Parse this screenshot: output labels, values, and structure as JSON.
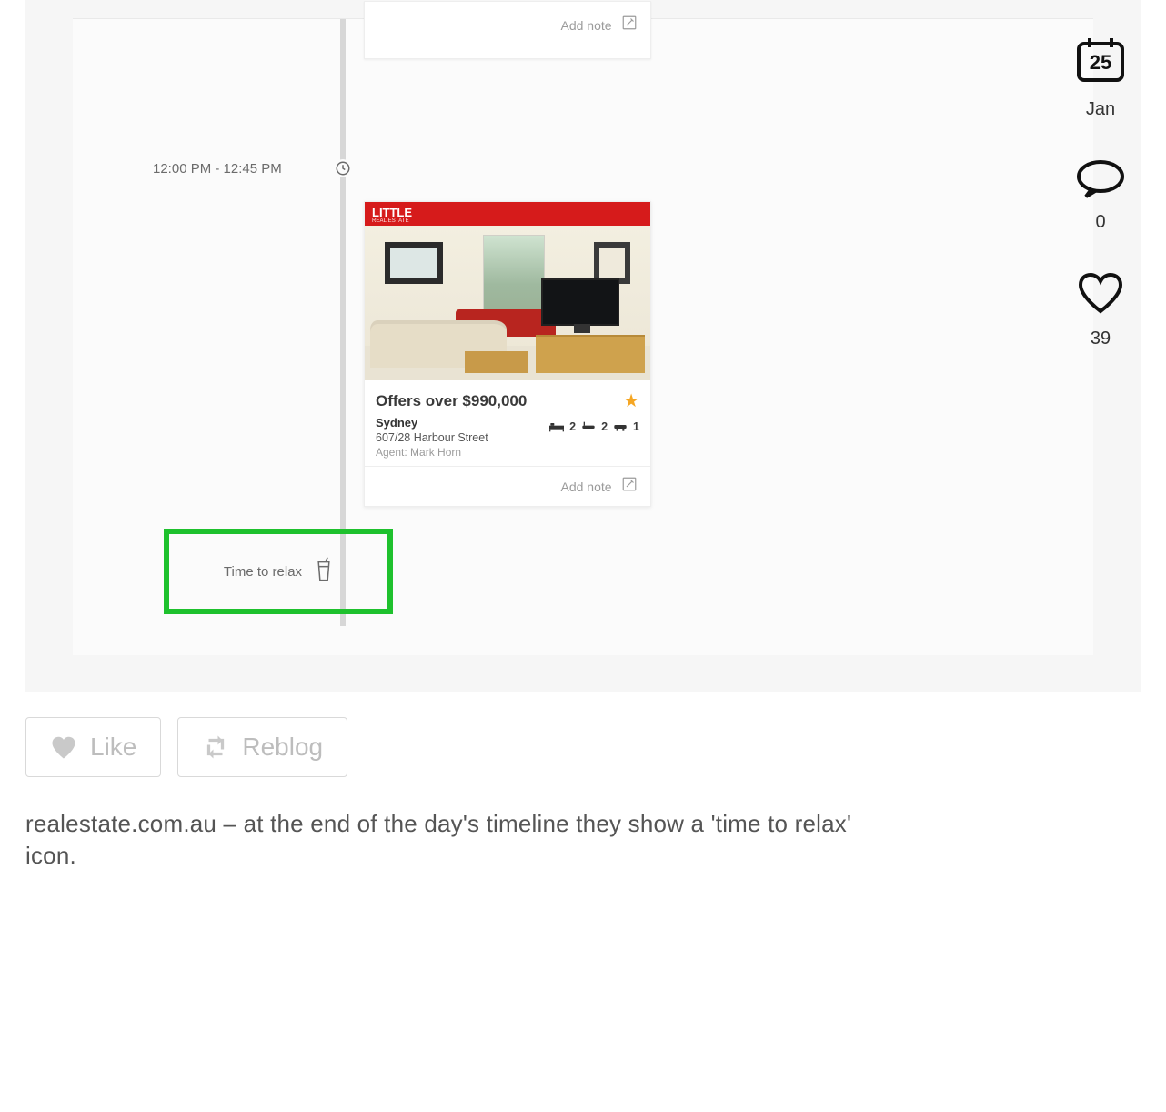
{
  "timeline": {
    "time_label": "12:00 PM - 12:45 PM",
    "add_note_label": "Add note",
    "relax_label": "Time to relax"
  },
  "card": {
    "brand": "LITTLE",
    "brand_sub": "REAL ESTATE",
    "price": "Offers over $990,000",
    "city": "Sydney",
    "address": "607/28 Harbour Street",
    "agent": "Agent: Mark Horn",
    "beds": "2",
    "baths": "2",
    "cars": "1",
    "add_note_label": "Add note"
  },
  "buttons": {
    "like": "Like",
    "reblog": "Reblog"
  },
  "caption": "realestate.com.au – at the end of the day's timeline they show a 'time to relax' icon.",
  "sidebar": {
    "day": "25",
    "month": "Jan",
    "comments": "0",
    "likes": "39"
  }
}
